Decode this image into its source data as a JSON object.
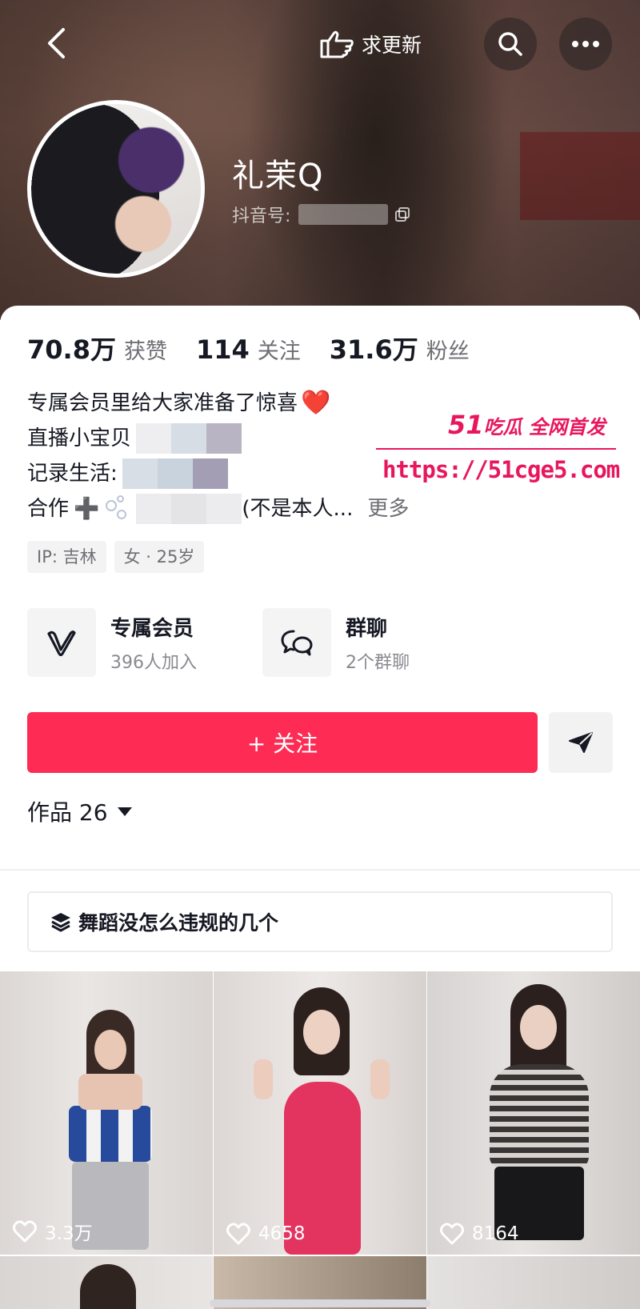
{
  "header": {
    "update_label": "求更新",
    "colors": {
      "overlay_button": "#28232380"
    }
  },
  "profile": {
    "nickname": "礼茉Q",
    "douyin_id_label": "抖音号:"
  },
  "stats": [
    {
      "value": "70.8万",
      "label": "获赞"
    },
    {
      "value": "114",
      "label": "关注"
    },
    {
      "value": "31.6万",
      "label": "粉丝"
    }
  ],
  "bio": {
    "line1": "专属会员里给大家准备了惊喜",
    "line1_emoji": "❤️",
    "line2": "直播小宝贝",
    "line3": "记录生活:",
    "line4_prefix": "合作",
    "line4_plus": "➕",
    "line4_suffix": "(不是本人...",
    "more": "更多"
  },
  "watermark": {
    "brand": "51",
    "brand_text": "吃瓜 全网首发",
    "url": "https://51cge5.com"
  },
  "tags": [
    "IP: 吉林",
    "女 · 25岁"
  ],
  "features": [
    {
      "title": "专属会员",
      "subtitle": "396人加入",
      "icon": "v-badge-icon"
    },
    {
      "title": "群聊",
      "subtitle": "2个群聊",
      "icon": "chat-bubbles-icon"
    }
  ],
  "actions": {
    "follow_label": "+ 关注",
    "colors": {
      "follow": "#fe2c55"
    }
  },
  "works": {
    "header": "作品 26",
    "collection_label": "舞蹈没怎么违规的几个",
    "videos": [
      {
        "likes": "3.3万"
      },
      {
        "likes": "4658"
      },
      {
        "likes": "8164"
      }
    ]
  }
}
